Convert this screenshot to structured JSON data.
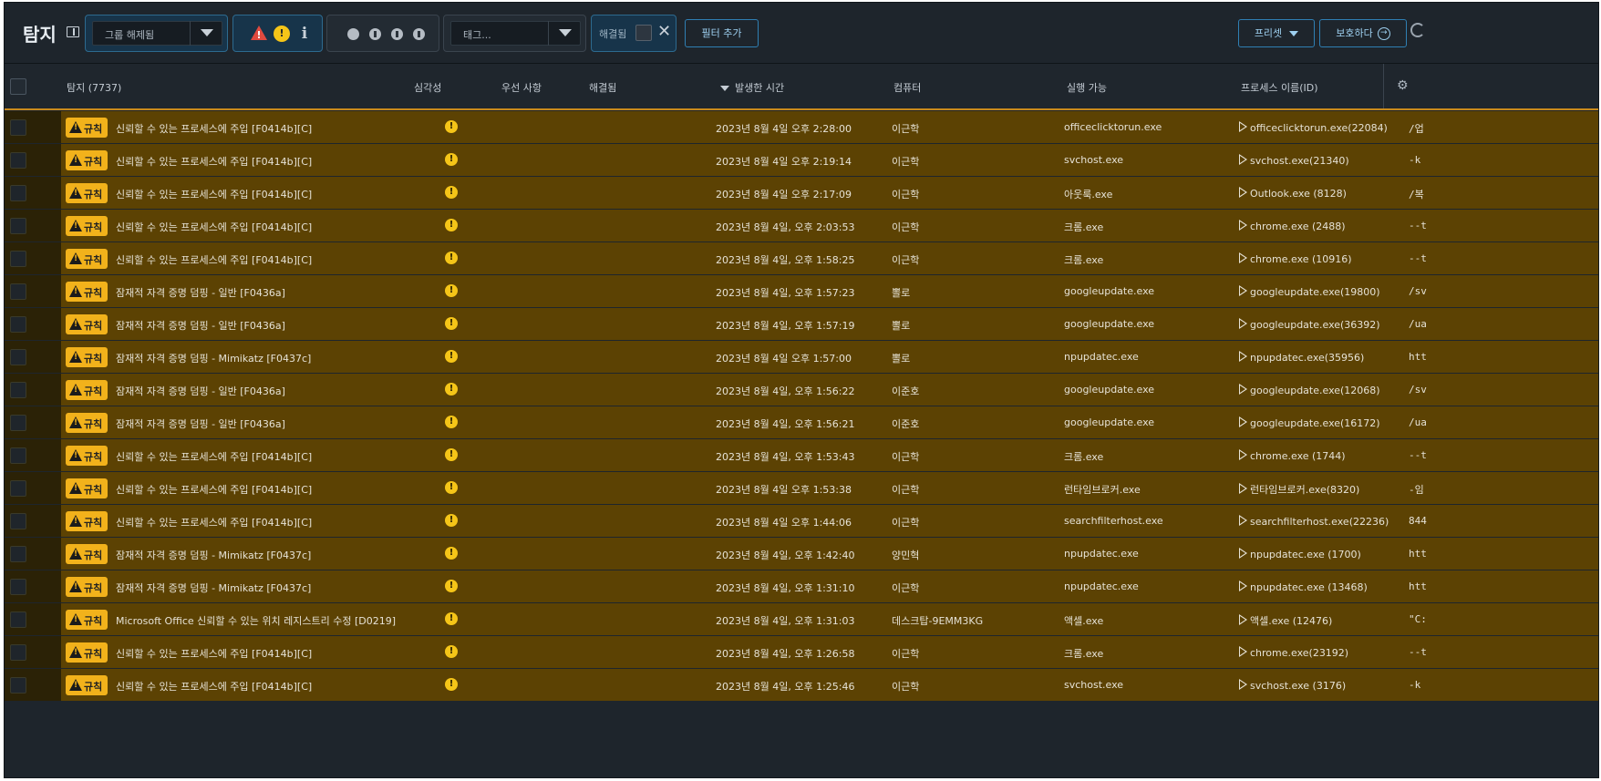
{
  "toolbar": {
    "title": "탐지",
    "group_select": "그룹 해제됨",
    "severity_filters": [
      "critical",
      "high",
      "info"
    ],
    "tag_select": "태그...",
    "resolved_label": "해결됨",
    "add_filter": "필터 추가",
    "preset": "프리셋",
    "protect": "보호하다"
  },
  "table": {
    "headers": {
      "detection": "탐지 (7737)",
      "severity": "심각성",
      "priority": "우선 사항",
      "resolved": "해결됨",
      "time": "발생한 시간",
      "computer": "컴퓨터",
      "executable": "실행 가능",
      "process": "프로세스 이름(ID)"
    },
    "rows": [
      {
        "badge": "규칙",
        "name": "신뢰할 수 있는 프로세스에 주입 [F0414b][C]",
        "time": "2023년 8월 4일 오후 2:28:00",
        "computer": "이근학",
        "exe": "officeclicktorun.exe",
        "process": "officeclicktorun.exe(22084)",
        "cmd": "/업",
        "child": true
      },
      {
        "badge": "규칙",
        "name": "신뢰할 수 있는 프로세스에 주입 [F0414b][C]",
        "time": "2023년 8월 4일 오후 2:19:14",
        "computer": "이근학",
        "exe": "svchost.exe",
        "process": "svchost.exe(21340)",
        "cmd": "-k",
        "child": true
      },
      {
        "badge": "규칙",
        "name": "신뢰할 수 있는 프로세스에 주입 [F0414b][C]",
        "time": "2023년 8월 4일 오후 2:17:09",
        "computer": "이근학",
        "exe": "아웃룩.exe",
        "process": "Outlook.exe (8128)",
        "cmd": "/복",
        "child": false
      },
      {
        "badge": "규칙",
        "name": "신뢰할 수 있는 프로세스에 주입 [F0414b][C]",
        "time": "2023년 8월 4일, 오후 2:03:53",
        "computer": "이근학",
        "exe": "크롬.exe",
        "process": "chrome.exe (2488)",
        "cmd": "--t",
        "child": true
      },
      {
        "badge": "규칙",
        "name": "신뢰할 수 있는 프로세스에 주입 [F0414b][C]",
        "time": "2023년 8월 4일, 오후 1:58:25",
        "computer": "이근학",
        "exe": "크롬.exe",
        "process": "chrome.exe (10916)",
        "cmd": "--t",
        "child": true
      },
      {
        "badge": "규칙",
        "name": "잠재적 자격 증명 덤핑 - 일반 [F0436a]",
        "time": "2023년 8월 4일, 오후 1:57:23",
        "computer": "뽈로",
        "exe": "googleupdate.exe",
        "process": "googleupdate.exe(19800)",
        "cmd": "/sv",
        "child": true
      },
      {
        "badge": "규칙",
        "name": "잠재적 자격 증명 덤핑 - 일반 [F0436a]",
        "time": "2023년 8월 4일, 오후 1:57:19",
        "computer": "뽈로",
        "exe": "googleupdate.exe",
        "process": "googleupdate.exe(36392)",
        "cmd": "/ua",
        "child": true
      },
      {
        "badge": "규칙",
        "name": "잠재적 자격 증명 덤핑 - Mimikatz [F0437c]",
        "time": "2023년 8월 4일 오후 1:57:00",
        "computer": "뽈로",
        "exe": "npupdatec.exe",
        "process": "npupdatec.exe(35956)",
        "cmd": "htt",
        "child": true
      },
      {
        "badge": "규칙",
        "name": "잠재적 자격 증명 덤핑 - 일반 [F0436a]",
        "time": "2023년 8월 4일, 오후 1:56:22",
        "computer": "이준호",
        "exe": "googleupdate.exe",
        "process": "googleupdate.exe(12068)",
        "cmd": "/sv",
        "child": true
      },
      {
        "badge": "규칙",
        "name": "잠재적 자격 증명 덤핑 - 일반 [F0436a]",
        "time": "2023년 8월 4일, 오후 1:56:21",
        "computer": "이준호",
        "exe": "googleupdate.exe",
        "process": "googleupdate.exe(16172)",
        "cmd": "/ua",
        "child": true
      },
      {
        "badge": "규칙",
        "name": "신뢰할 수 있는 프로세스에 주입 [F0414b][C]",
        "time": "2023년 8월 4일, 오후 1:53:43",
        "computer": "이근학",
        "exe": "크롬.exe",
        "process": "chrome.exe (1744)",
        "cmd": "--t",
        "child": true
      },
      {
        "badge": "규칙",
        "name": "신뢰할 수 있는 프로세스에 주입 [F0414b][C]",
        "time": "2023년 8월 4일 오후 1:53:38",
        "computer": "이근학",
        "exe": "런타임브로커.exe",
        "process": "런타임브로커.exe(8320)",
        "cmd": "-임",
        "child": false
      },
      {
        "badge": "규칙",
        "name": "신뢰할 수 있는 프로세스에 주입 [F0414b][C]",
        "time": "2023년 8월 4일 오후 1:44:06",
        "computer": "이근학",
        "exe": "searchfilterhost.exe",
        "process": "searchfilterhost.exe(22236)",
        "cmd": "844",
        "child": false
      },
      {
        "badge": "규칙",
        "name": "잠재적 자격 증명 덤핑 - Mimikatz [F0437c]",
        "time": "2023년 8월 4일, 오후 1:42:40",
        "computer": "양민혁",
        "exe": "npupdatec.exe",
        "process": "npupdatec.exe (1700)",
        "cmd": "htt",
        "child": true
      },
      {
        "badge": "규칙",
        "name": "잠재적 자격 증명 덤핑 - Mimikatz [F0437c]",
        "time": "2023년 8월 4일, 오후 1:31:10",
        "computer": "이근학",
        "exe": "npupdatec.exe",
        "process": "npupdatec.exe (13468)",
        "cmd": "htt",
        "child": true
      },
      {
        "badge": "규칙",
        "name": "Microsoft Office 신뢰할 수 있는 위치 레지스트리 수정 [D0219]",
        "time": "2023년 8월 4일, 오후 1:31:03",
        "computer": "데스크탑-9EMM3KG",
        "exe": "액셀.exe",
        "process": "액셀.exe (12476)",
        "cmd": "\"C:",
        "child": false
      },
      {
        "badge": "규칙",
        "name": "신뢰할 수 있는 프로세스에 주입 [F0414b][C]",
        "time": "2023년 8월 4일, 오후 1:26:58",
        "computer": "이근학",
        "exe": "크롬.exe",
        "process": "chrome.exe(23192)",
        "cmd": "--t",
        "child": true
      },
      {
        "badge": "규칙",
        "name": "신뢰할 수 있는 프로세스에 주입 [F0414b][C]",
        "time": "2023년 8월 4일, 오후 1:25:46",
        "computer": "이근학",
        "exe": "svchost.exe",
        "process": "svchost.exe (3176)",
        "cmd": "-k",
        "child": true
      }
    ]
  },
  "colors": {
    "row_band": "#5c4203",
    "badge": "#f2b21b",
    "severity_high": "#f5c518",
    "accent": "#2f7fb3"
  }
}
